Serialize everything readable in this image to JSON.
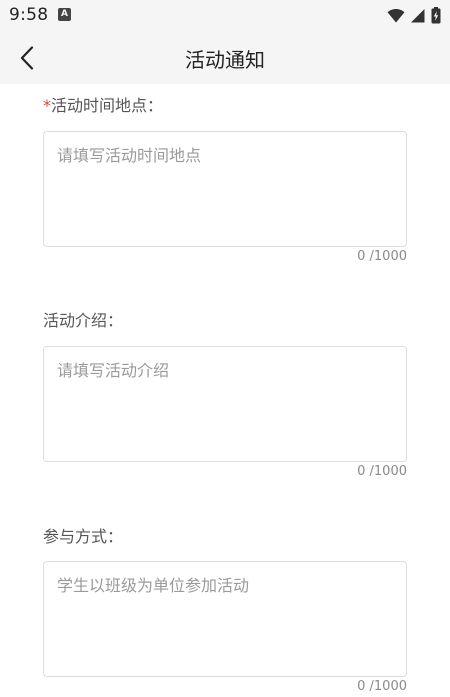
{
  "status_bar": {
    "time": "9:58",
    "app_icon_letter": "A",
    "icons": [
      "wifi-icon",
      "signal-icon",
      "battery-charging-icon"
    ]
  },
  "app_bar": {
    "back_icon": "chevron-left-icon",
    "title": "活动通知"
  },
  "form": {
    "fields": [
      {
        "required_mark": "*",
        "label": "活动时间地点：",
        "value": "",
        "placeholder": "请填写活动时间地点",
        "counter": "0 /1000"
      },
      {
        "label": "活动介绍：",
        "value": "",
        "placeholder": "请填写活动介绍",
        "counter": "0 /1000"
      },
      {
        "label": "参与方式：",
        "value": "",
        "placeholder": "学生以班级为单位参加活动",
        "counter": "0 /1000"
      }
    ]
  },
  "colors": {
    "required": "#e0403a",
    "label": "#555555",
    "placeholder": "#9a9a9a",
    "border": "#dedede",
    "background": "#f5f5f5"
  }
}
